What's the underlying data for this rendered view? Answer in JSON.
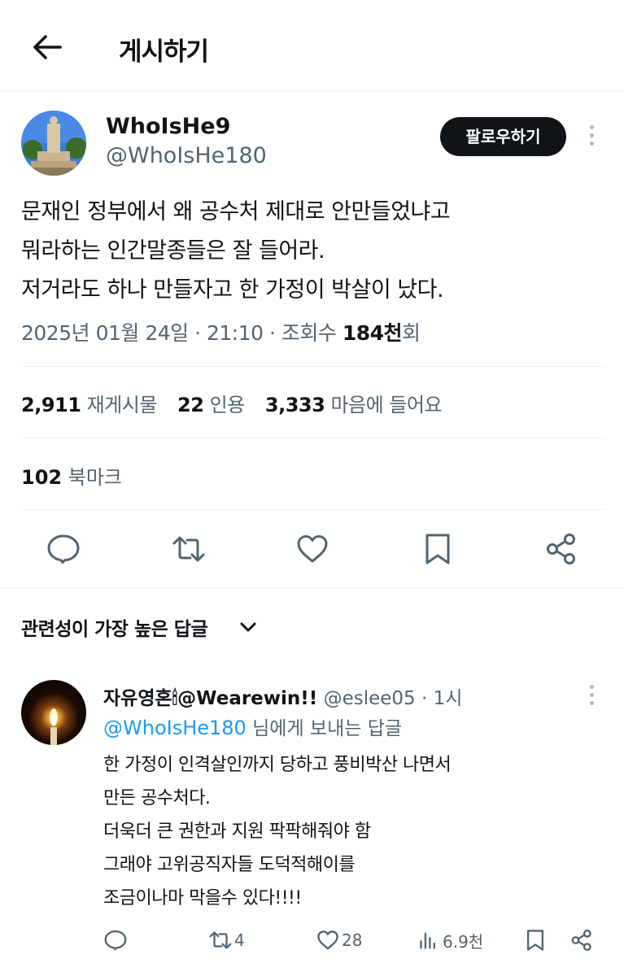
{
  "header": {
    "title": "게시하기",
    "back_icon": "arrow-left-icon"
  },
  "post": {
    "display_name": "WhoIsHe9",
    "handle": "@WhoIsHe180",
    "follow_label": "팔로우하기",
    "text_lines": [
      "문재인 정부에서 왜 공수처 제대로 안만들었냐고",
      "뭐라하는 인간말종들은 잘 들어라.",
      "저거라도 하나 만들자고 한 가정이 박살이 났다."
    ],
    "meta_prefix": "2025년 01월 24일 · 21:10 · 조회수 ",
    "views_value": "184천",
    "views_suffix": "회",
    "stats": {
      "retweets": "2,911",
      "retweets_label": "재게시물",
      "quotes": "22",
      "quotes_label": "인용",
      "likes": "3,333",
      "likes_label": "마음에 들어요",
      "bookmarks": "102",
      "bookmarks_label": "북마크"
    },
    "actions": [
      "reply-icon",
      "retweet-icon",
      "heart-icon",
      "bookmark-icon",
      "share-icon"
    ]
  },
  "sort_label": "관련성이 가장 높은 답글",
  "reply": {
    "display_name": "자유영혼🕯@Wearewin!!",
    "handle": "@eslee05",
    "time": "· 1시",
    "reply_to_handle": "@WhoIsHe180",
    "reply_to_suffix": " 님에게 보내는 답글",
    "text_lines": [
      "한 가정이 인격살인까지 당하고 풍비박산 나면서",
      "만든 공수처다.",
      "더욱더 큰 권한과 지원 팍팍해줘야 함",
      "그래야 고위공직자들 도덕적해이를",
      "조금이나마 막을수 있다!!!!"
    ],
    "retweets": "4",
    "likes": "28",
    "views": "6.9천"
  },
  "colors": {
    "accent": "#1d9bf0",
    "text": "#0f1419",
    "muted": "#536471",
    "divider": "#eff3f4"
  }
}
